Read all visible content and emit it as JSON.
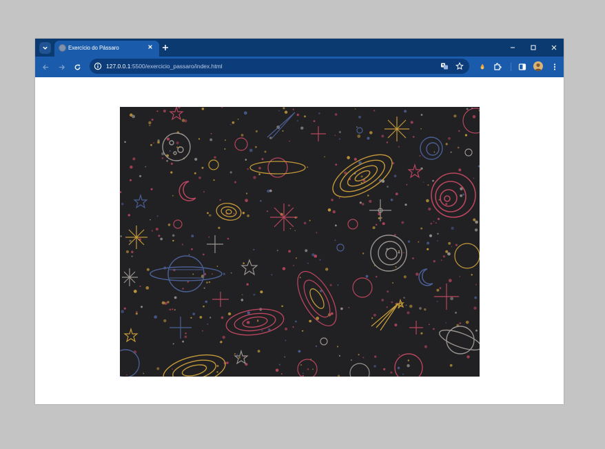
{
  "browser": {
    "tab_title": "Exercício do Pássaro",
    "url_host": "127.0.0.1",
    "url_path": ":5500/exercicio_passaro/index.html"
  },
  "page": {
    "image_alt": "Fundo de espaço com planetas, estrelas e galáxias"
  },
  "colors": {
    "tabstrip": "#0a3a70",
    "toolbar": "#1a5cab",
    "omnibox": "#0c3c7a",
    "page_background": "#ffffff",
    "image_background": "#212022"
  }
}
